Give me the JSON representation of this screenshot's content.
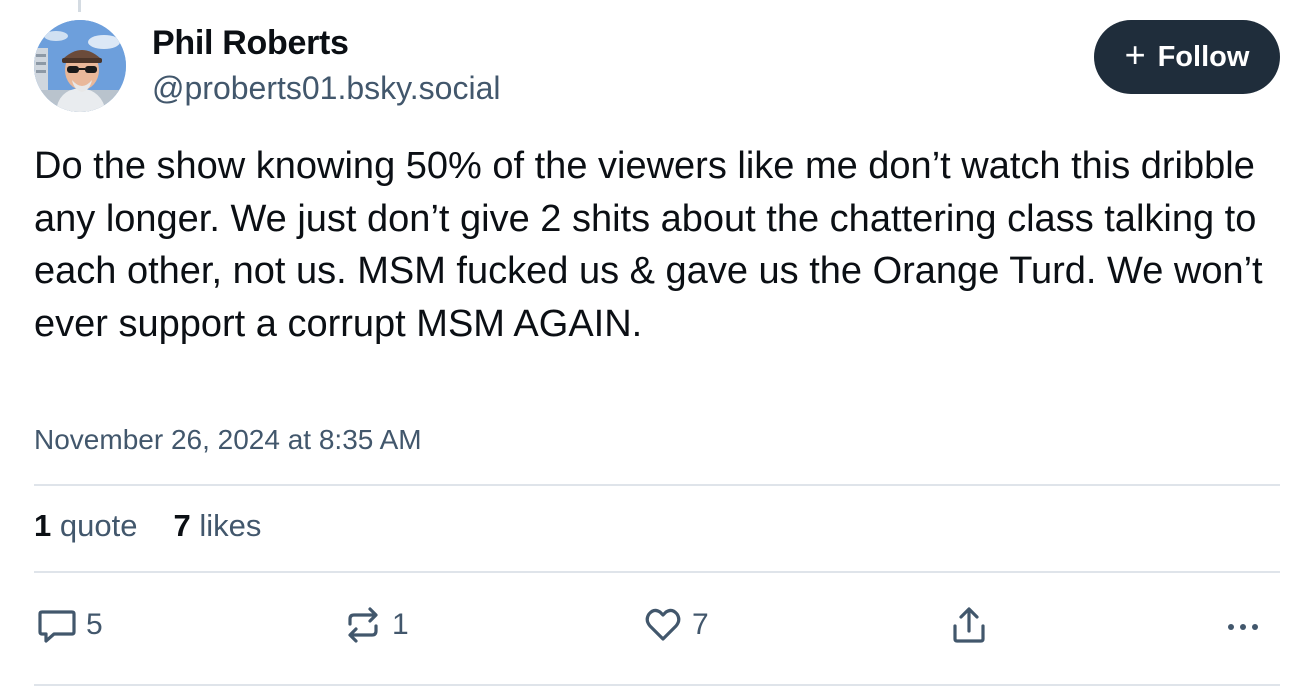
{
  "post": {
    "author": {
      "display_name": "Phil Roberts",
      "handle": "@proberts01.bsky.social"
    },
    "follow_button": {
      "label": "Follow",
      "icon": "plus-icon"
    },
    "text": "Do the show knowing 50% of the viewers like me don’t watch this dribble any longer. We just don’t give 2 shits about the chattering class talking to each other, not us. MSM fucked us & gave us the Orange Turd. We won’t ever support a corrupt MSM AGAIN.",
    "timestamp": "November 26, 2024 at 8:35 AM",
    "stats": {
      "quotes_count": "1",
      "quotes_label": "quote",
      "likes_count": "7",
      "likes_label": "likes"
    },
    "actions": {
      "reply": {
        "icon": "reply-icon",
        "count": "5"
      },
      "repost": {
        "icon": "repost-icon",
        "count": "1"
      },
      "like": {
        "icon": "heart-icon",
        "count": "7"
      },
      "share": {
        "icon": "share-icon"
      },
      "more": {
        "icon": "more-icon"
      }
    }
  },
  "colors": {
    "text_primary": "#0b0f14",
    "text_secondary": "#42576c",
    "follow_button_bg": "#1f2d3b",
    "divider": "#dfe4ea"
  }
}
